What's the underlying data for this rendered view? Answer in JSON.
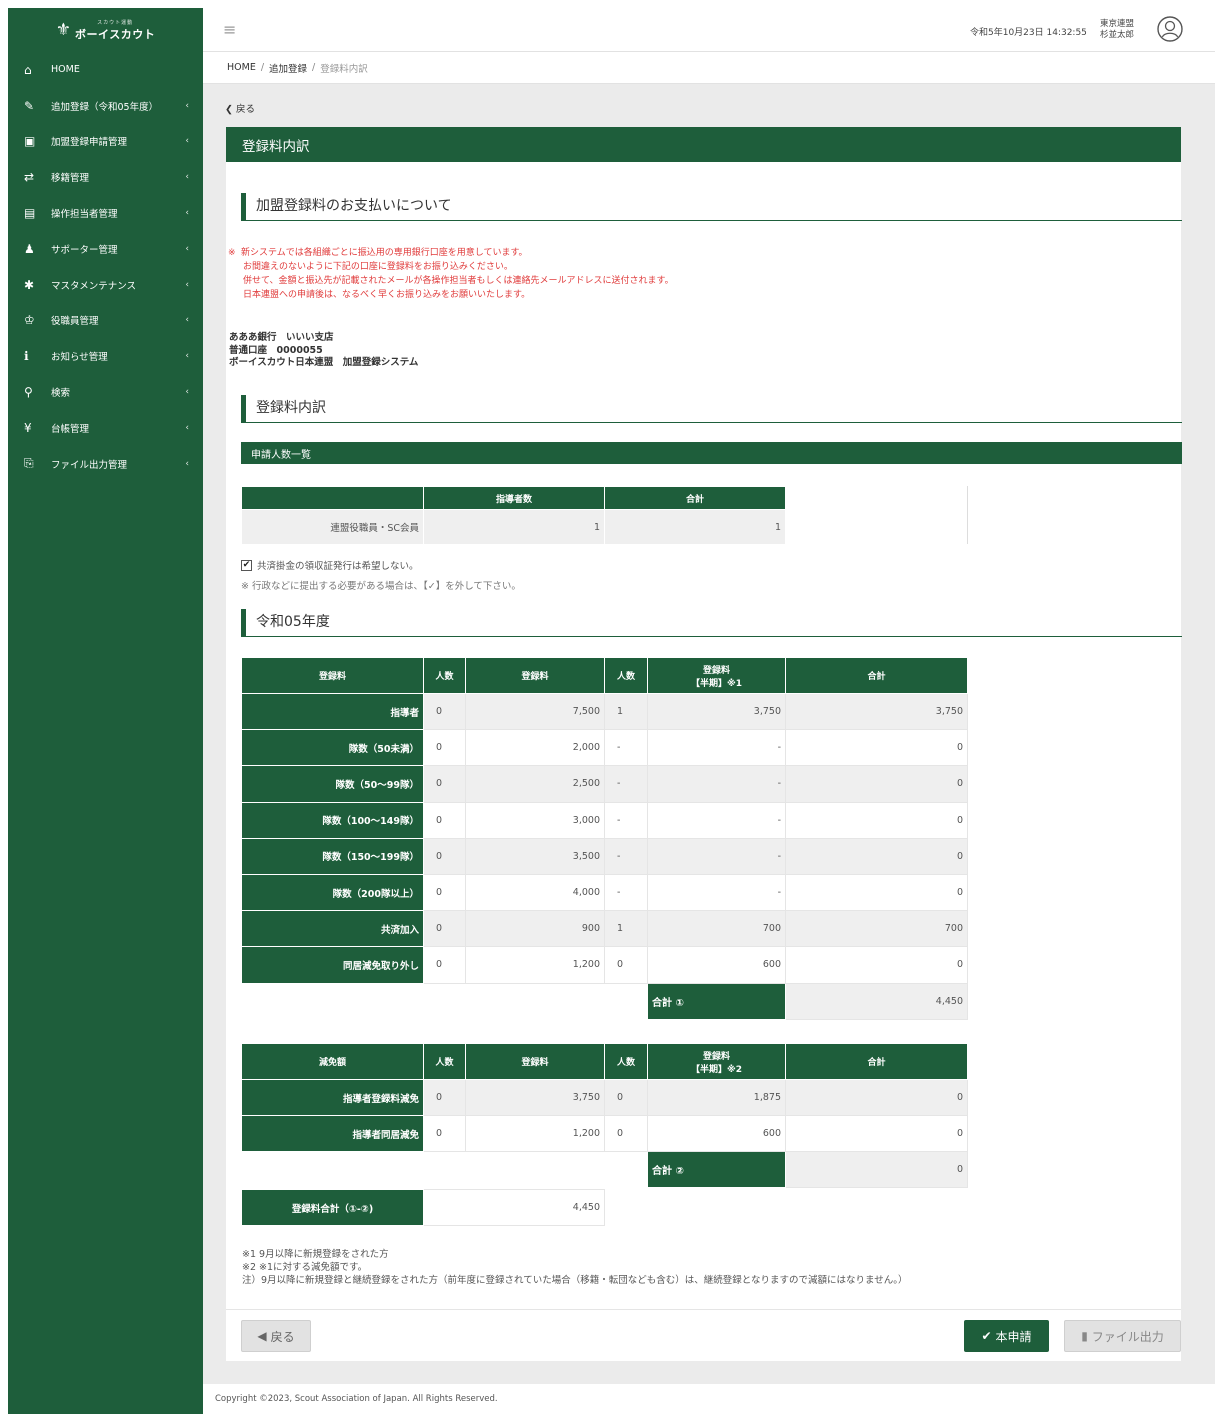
{
  "sidebar": {
    "logo_small": "スカウト運動",
    "logo_main": "ボーイスカウト",
    "items": [
      {
        "icon": "⌂",
        "label": "HOME",
        "chevron": ""
      },
      {
        "icon": "✎",
        "label": "追加登録（令和05年度）",
        "chevron": "‹"
      },
      {
        "icon": "▣",
        "label": "加盟登録申請管理",
        "chevron": "‹"
      },
      {
        "icon": "⇄",
        "label": "移籍管理",
        "chevron": "‹"
      },
      {
        "icon": "▤",
        "label": "操作担当者管理",
        "chevron": "‹"
      },
      {
        "icon": "♟",
        "label": "サポーター管理",
        "chevron": "‹"
      },
      {
        "icon": "✱",
        "label": "マスタメンテナンス",
        "chevron": "‹"
      },
      {
        "icon": "♔",
        "label": "役職員管理",
        "chevron": "‹"
      },
      {
        "icon": "ℹ",
        "label": "お知らせ管理",
        "chevron": "‹"
      },
      {
        "icon": "⚲",
        "label": "検索",
        "chevron": "‹"
      },
      {
        "icon": "¥",
        "label": "台帳管理",
        "chevron": "‹"
      },
      {
        "icon": "⎘",
        "label": "ファイル出力管理",
        "chevron": "‹"
      }
    ]
  },
  "header": {
    "datetime": "令和5年10月23日 14:32:55",
    "org": "東京連盟",
    "user": "杉並太郎"
  },
  "breadcrumb": {
    "home": "HOME",
    "parent": "追加登録",
    "current": "登録料内訳",
    "sep": "/"
  },
  "back_link": "戻る",
  "card": {
    "title": "登録料内訳",
    "section_payment": "加盟登録料のお支払いについて",
    "notice": {
      "mark": "※",
      "lines": [
        "新システムでは各組織ごとに振込用の専用銀行口座を用意しています。",
        "お間違えのないように下記の口座に登録料をお振り込みください。",
        "併せて、金額と振込先が記載されたメールが各操作担当者もしくは連絡先メールアドレスに送付されます。",
        "日本連盟への申請後は、なるべく早くお振り込みをお願いいたします。"
      ]
    },
    "bank": {
      "line1": "あああ銀行　いいい支店",
      "line2": "普通口座　0000055",
      "line3": "ボーイスカウト日本連盟　加盟登録システム"
    },
    "section_breakdown": "登録料内訳",
    "applicants_bar": "申請人数一覧",
    "summary": {
      "headers": [
        "",
        "指導者数",
        "合計"
      ],
      "row": {
        "label": "連盟役職員・SC会員",
        "leaders": "1",
        "total": "1"
      }
    },
    "checkbox_label": "共済掛金の領収証発行は希望しない。",
    "checkbox_note": "※ 行政などに提出する必要がある場合は、【✓】を外して下さい。",
    "section_year": "令和05年度",
    "fee_table": {
      "headers": [
        "登録料",
        "人数",
        "登録料",
        "人数",
        "登録料",
        "【半期】※1",
        "合計"
      ],
      "rows": [
        {
          "label": "指導者",
          "n1": "0",
          "fee": "7,500",
          "n2": "1",
          "half": "3,750",
          "total": "3,750"
        },
        {
          "label": "隊数（50未満）",
          "n1": "0",
          "fee": "2,000",
          "n2": "-",
          "half": "-",
          "total": "0"
        },
        {
          "label": "隊数（50～99隊）",
          "n1": "0",
          "fee": "2,500",
          "n2": "-",
          "half": "-",
          "total": "0"
        },
        {
          "label": "隊数（100～149隊）",
          "n1": "0",
          "fee": "3,000",
          "n2": "-",
          "half": "-",
          "total": "0"
        },
        {
          "label": "隊数（150～199隊）",
          "n1": "0",
          "fee": "3,500",
          "n2": "-",
          "half": "-",
          "total": "0"
        },
        {
          "label": "隊数（200隊以上）",
          "n1": "0",
          "fee": "4,000",
          "n2": "-",
          "half": "-",
          "total": "0"
        },
        {
          "label": "共済加入",
          "n1": "0",
          "fee": "900",
          "n2": "1",
          "half": "700",
          "total": "700"
        },
        {
          "label": "同居減免取り外し",
          "n1": "0",
          "fee": "1,200",
          "n2": "0",
          "half": "600",
          "total": "0"
        }
      ],
      "total_label": "合計 ①",
      "total_value": "4,450"
    },
    "reduction_table": {
      "headers": [
        "減免額",
        "人数",
        "登録料",
        "人数",
        "登録料",
        "【半期】※2",
        "合計"
      ],
      "rows": [
        {
          "label": "指導者登録料減免",
          "n1": "0",
          "fee": "3,750",
          "n2": "0",
          "half": "1,875",
          "total": "0"
        },
        {
          "label": "指導者同居減免",
          "n1": "0",
          "fee": "1,200",
          "n2": "0",
          "half": "600",
          "total": "0"
        }
      ],
      "total_label": "合計 ②",
      "total_value": "0"
    },
    "grand_total": {
      "label": "登録料合計（①-②)",
      "value": "4,450"
    },
    "footnotes": [
      "※1 9月以降に新規登録をされた方",
      "※2 ※1に対する減免額です。",
      "注）9月以降に新規登録と継続登録をされた方（前年度に登録されていた場合（移籍・転団なども含む）は、継続登録となりますので減額にはなりません。）"
    ],
    "buttons": {
      "back": "戻る",
      "apply": "本申請",
      "file": "ファイル出力"
    }
  },
  "footer": "Copyright ©2023, Scout Association of Japan. All Rights Reserved.",
  "colors": {
    "brand_green": "#1e5e3b",
    "notice_red": "#e03b3b",
    "shade": "#efefef"
  }
}
